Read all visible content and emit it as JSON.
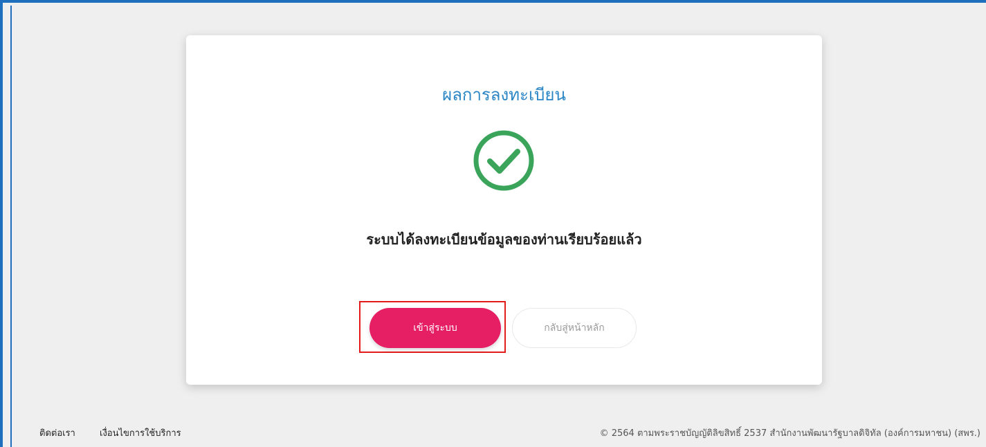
{
  "card": {
    "title": "ผลการลงทะเบียน",
    "status_icon": "check-circle-icon",
    "message": "ระบบได้ลงทะเบียนข้อมูลของท่านเรียบร้อยแล้ว",
    "primary_button_label": "เข้าสู่ระบบ",
    "secondary_button_label": "กลับสู่หน้าหลัก"
  },
  "footer": {
    "contact_label": "ติดต่อเรา",
    "terms_label": "เงื่อนไขการใช้บริการ",
    "copyright": "© 2564 ตามพระราชบัญญัติลิขสิทธิ์ 2537 สำนักงานพัฒนารัฐบาลดิจิทัล (องค์การมหาชน) (สพร.)"
  },
  "colors": {
    "title": "#2b86c5",
    "success": "#3aa55a",
    "primary_button": "#e61e63",
    "highlight_box": "#e31b1b",
    "frame_border": "#1f6fbf"
  }
}
